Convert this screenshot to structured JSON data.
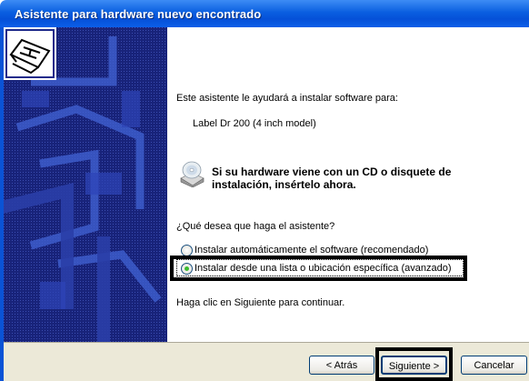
{
  "window": {
    "title": "Asistente para hardware nuevo encontrado"
  },
  "content": {
    "intro": "Este asistente le ayudará a instalar software para:",
    "device_name": "Label Dr 200 (4 inch model)",
    "cd_prompt": "Si su hardware viene con un CD o disquete de instalación, insértelo ahora.",
    "question": "¿Qué desea que haga el asistente?",
    "options": [
      {
        "label": "Instalar automáticamente el software (recomendado)",
        "selected": false
      },
      {
        "label": "Instalar desde una lista o ubicación específica (avanzado)",
        "selected": true
      }
    ],
    "continue_hint": "Haga clic en Siguiente para continuar."
  },
  "buttons": {
    "back": "< Atrás",
    "next": "Siguiente >",
    "cancel": "Cancelar"
  },
  "colors": {
    "titlebar": "#0550d8",
    "side_panel": "#1e2a8a",
    "button_bar": "#ece9d8",
    "selected_radio": "#3dbb2f"
  },
  "icons": [
    "hardware-card-icon",
    "cd-drive-icon"
  ]
}
